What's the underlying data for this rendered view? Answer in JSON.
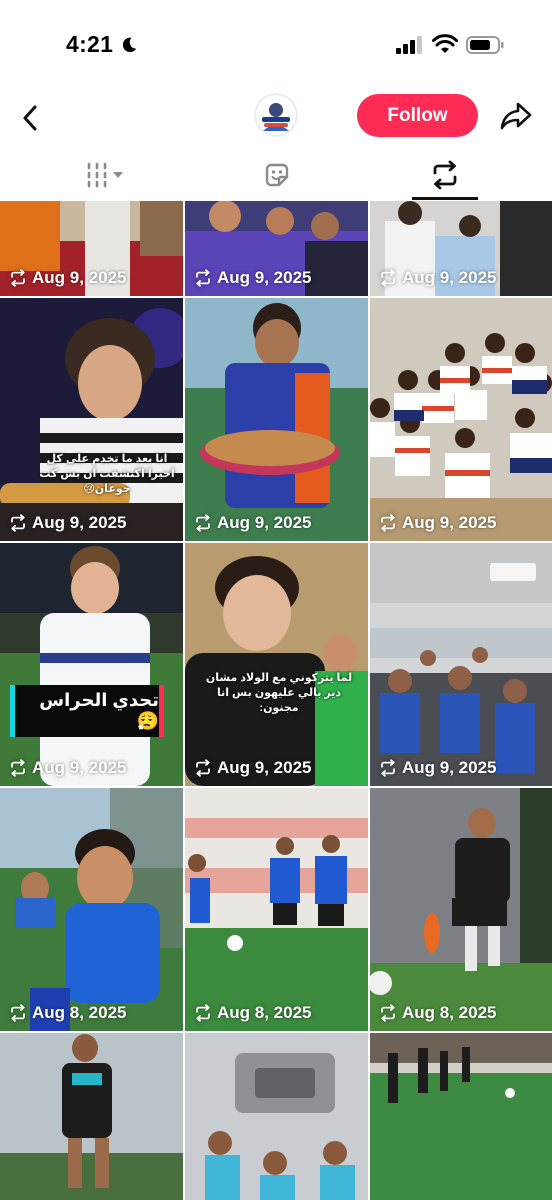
{
  "status_bar": {
    "time": "4:21",
    "icons": [
      "moon-icon",
      "cellular-signal-icon",
      "wifi-icon",
      "battery-icon"
    ]
  },
  "header": {
    "follow_label": "Follow",
    "icons": [
      "back-arrow-icon",
      "share-icon"
    ]
  },
  "tabs": [
    {
      "name": "videos",
      "icon": "grid-columns-icon",
      "dropdown": true
    },
    {
      "name": "liked",
      "icon": "sticker-icon"
    },
    {
      "name": "reposts",
      "icon": "repost-icon",
      "active": true
    }
  ],
  "grid": {
    "tiles": [
      {
        "date": "Aug 9, 2025"
      },
      {
        "date": "Aug 9, 2025"
      },
      {
        "date": "Aug 9, 2025"
      },
      {
        "date": "Aug 9, 2025",
        "caption": "انا بعد ما تخدم على كل اخيرا اكتشفت ان بس كت جوعان😢"
      },
      {
        "date": "Aug 9, 2025"
      },
      {
        "date": "Aug 9, 2025"
      },
      {
        "date": "Aug 9, 2025",
        "caption": "تحدي الحراس 😮‍💨"
      },
      {
        "date": "Aug 9, 2025",
        "caption": "لما يتركوني مع الولاد مشان دير بالي عليهون بس انا مجنون:"
      },
      {
        "date": "Aug 9, 2025"
      },
      {
        "date": "Aug 8, 2025"
      },
      {
        "date": "Aug 8, 2025"
      },
      {
        "date": "Aug 8, 2025"
      },
      {
        "date": ""
      },
      {
        "date": ""
      },
      {
        "date": ""
      }
    ]
  },
  "colors": {
    "accent": "#fe2c55",
    "text": "#111111",
    "tab_inactive": "#8a8a8a"
  }
}
